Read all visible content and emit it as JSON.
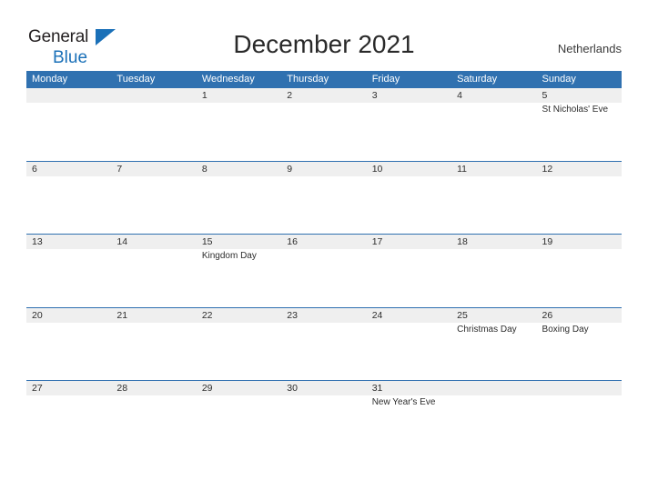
{
  "brand": {
    "name_part1": "General",
    "name_part2": "Blue",
    "triangle_icon": "logo-triangle-icon",
    "color_dark": "#231f20",
    "color_blue": "#1a70b8"
  },
  "header": {
    "title": "December 2021",
    "country": "Netherlands"
  },
  "theme": {
    "header_blue": "#3071b0",
    "row_line_blue": "#2e6fb0",
    "date_band_gray": "#efefef",
    "text_dark": "#2d2d2d",
    "page_background": "#ffffff"
  },
  "calendar": {
    "month": "December",
    "year": "2021",
    "weekday_headers": [
      "Monday",
      "Tuesday",
      "Wednesday",
      "Thursday",
      "Friday",
      "Saturday",
      "Sunday"
    ],
    "weeks": [
      {
        "days": [
          {
            "number": "",
            "event": "",
            "empty": true
          },
          {
            "number": "",
            "event": "",
            "empty": true
          },
          {
            "number": "1",
            "event": ""
          },
          {
            "number": "2",
            "event": ""
          },
          {
            "number": "3",
            "event": ""
          },
          {
            "number": "4",
            "event": ""
          },
          {
            "number": "5",
            "event": "St Nicholas' Eve"
          }
        ]
      },
      {
        "days": [
          {
            "number": "6",
            "event": ""
          },
          {
            "number": "7",
            "event": ""
          },
          {
            "number": "8",
            "event": ""
          },
          {
            "number": "9",
            "event": ""
          },
          {
            "number": "10",
            "event": ""
          },
          {
            "number": "11",
            "event": ""
          },
          {
            "number": "12",
            "event": ""
          }
        ]
      },
      {
        "days": [
          {
            "number": "13",
            "event": ""
          },
          {
            "number": "14",
            "event": ""
          },
          {
            "number": "15",
            "event": "Kingdom Day"
          },
          {
            "number": "16",
            "event": ""
          },
          {
            "number": "17",
            "event": ""
          },
          {
            "number": "18",
            "event": ""
          },
          {
            "number": "19",
            "event": ""
          }
        ]
      },
      {
        "days": [
          {
            "number": "20",
            "event": ""
          },
          {
            "number": "21",
            "event": ""
          },
          {
            "number": "22",
            "event": ""
          },
          {
            "number": "23",
            "event": ""
          },
          {
            "number": "24",
            "event": ""
          },
          {
            "number": "25",
            "event": "Christmas Day"
          },
          {
            "number": "26",
            "event": "Boxing Day"
          }
        ]
      },
      {
        "days": [
          {
            "number": "27",
            "event": ""
          },
          {
            "number": "28",
            "event": ""
          },
          {
            "number": "29",
            "event": ""
          },
          {
            "number": "30",
            "event": ""
          },
          {
            "number": "31",
            "event": "New Year's Eve"
          },
          {
            "number": "",
            "event": "",
            "empty": true
          },
          {
            "number": "",
            "event": "",
            "empty": true
          }
        ]
      }
    ]
  }
}
